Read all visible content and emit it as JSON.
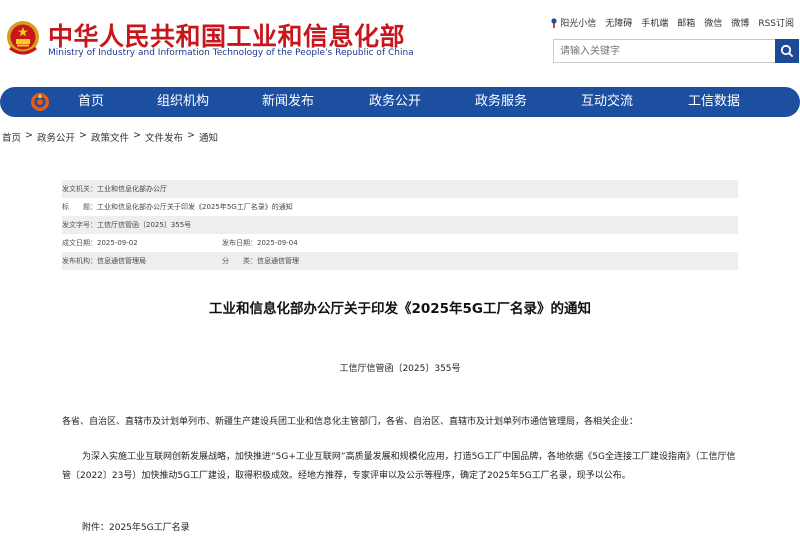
{
  "header": {
    "site_title_cn": "中华人民共和国工业和信息化部",
    "site_title_en": "Ministry of Industry and Information Technology of the People's Republic of China",
    "top_links": [
      "阳光小信",
      "无障碍",
      "手机端",
      "邮箱",
      "微信",
      "微博",
      "RSS订阅"
    ],
    "search_placeholder": "请输入关键字",
    "brand_color": "#c8161d",
    "accent_color": "#1d4fa0"
  },
  "nav": {
    "items": [
      "首页",
      "组织机构",
      "新闻发布",
      "政务公开",
      "政务服务",
      "互动交流",
      "工信数据"
    ]
  },
  "breadcrumb": [
    "首页",
    "政务公开",
    "政策文件",
    "文件发布",
    "通知"
  ],
  "breadcrumb_separator": ">",
  "meta": {
    "issuer_label": "发文机关：",
    "issuer_value": "工业和信息化部办公厅",
    "title_label": "标　　题：",
    "title_value": "工业和信息化部办公厅关于印发《2025年5G工厂名录》的通知",
    "docno_label": "发文字号：",
    "docno_value": "工信厅信管函〔2025〕355号",
    "created_label": "成文日期：",
    "created_value": "2025-09-02",
    "published_label": "发布日期：",
    "published_value": "2025-09-04",
    "org_label": "发布机构：",
    "org_value": "信息通信管理局",
    "category_label": "分　　类：",
    "category_value": "信息通信管理"
  },
  "article": {
    "title": "工业和信息化部办公厅关于印发《2025年5G工厂名录》的通知",
    "doc_number": "工信厅信管函〔2025〕355号",
    "salutation": "各省、自治区、直辖市及计划单列市、新疆生产建设兵团工业和信息化主管部门，各省、自治区、直辖市及计划单列市通信管理局，各相关企业：",
    "body": "为深入实施工业互联网创新发展战略，加快推进“5G+工业互联网”高质量发展和规模化应用，打造5G工厂中国品牌，各地依据《5G全连接工厂建设指南》（工信厅信管〔2022〕23号）加快推动5G工厂建设，取得积极成效。经地方推荐，专家评审以及公示等程序，确定了2025年5G工厂名录，现予以公布。",
    "attachment": "附件：2025年5G工厂名录"
  }
}
